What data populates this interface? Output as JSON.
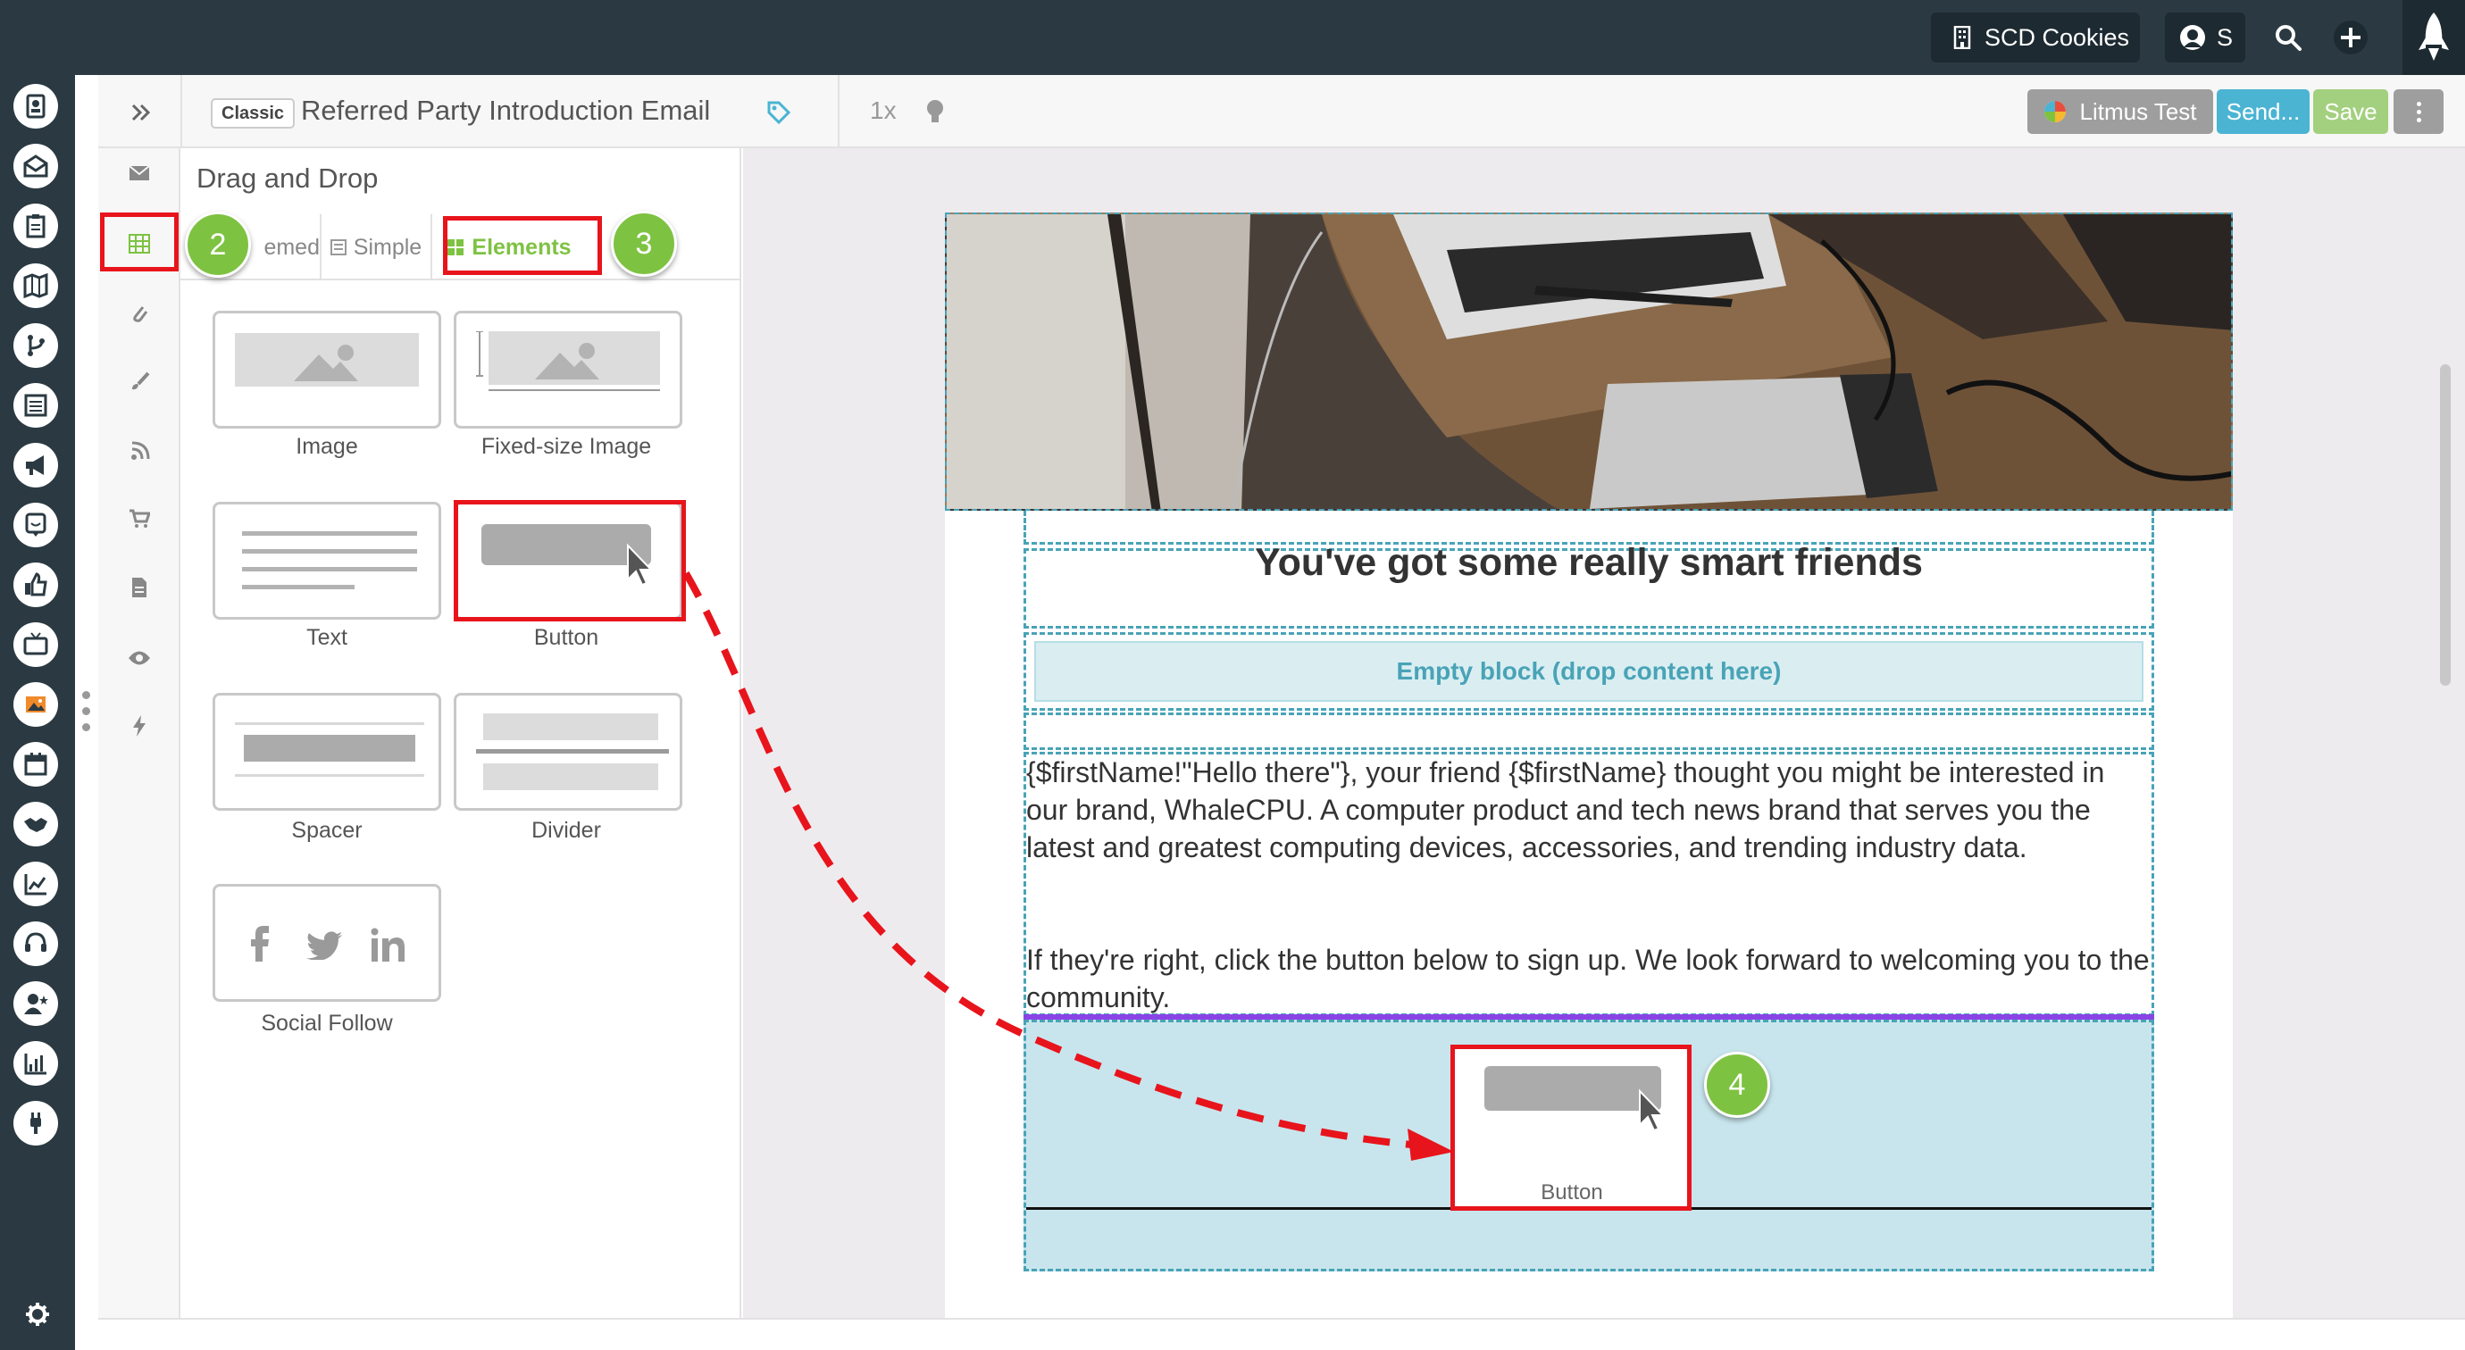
{
  "topbar": {
    "workspace": "SCD Cookies",
    "user_initial": "S"
  },
  "header": {
    "badge": "Classic",
    "title": "Referred Party Introduction Email",
    "zoom": "1x",
    "litmus_label": "Litmus Test",
    "send_label": "Send...",
    "save_label": "Save"
  },
  "palette": {
    "title": "Drag and Drop",
    "tabs": [
      "emed",
      "Simple",
      "Elements"
    ],
    "elements": [
      "Image",
      "Fixed-size Image",
      "Text",
      "Button",
      "Spacer",
      "Divider",
      "Social Follow"
    ]
  },
  "email": {
    "heading": "You've got some really smart friends",
    "empty_block": "Empty block (drop content here)",
    "paragraph1": "{$firstName!\"Hello there\"}, your friend {$firstName} thought you might be interested in our brand, WhaleCPU. A computer product and tech news brand that serves you the latest and greatest computing devices, accessories, and trending industry data.",
    "paragraph2": "If they're right, click the button below to sign up. We look forward to welcoming you to the community.",
    "drop_label": "Button"
  },
  "badges": [
    "2",
    "3",
    "4"
  ],
  "colors": {
    "rail_bg": "#2b3a42",
    "accent_green": "#7ec242",
    "send_blue": "#4bb4d3",
    "save_green": "#a3d07e",
    "highlight_red": "#e8141c",
    "teal": "#49a3b7"
  },
  "icons": {
    "rail": [
      "contacts-icon",
      "email-icon",
      "clipboard-icon",
      "map-icon",
      "branch-icon",
      "list-icon",
      "megaphone-icon",
      "chat-icon",
      "thumbs-up-icon",
      "tv-icon",
      "image-icon",
      "calendar-icon",
      "handshake-icon",
      "chart-up-icon",
      "headset-icon",
      "user-star-icon",
      "bar-chart-icon",
      "plug-icon"
    ],
    "tools": [
      "envelope-icon",
      "grid-icon",
      "paperclip-icon",
      "brush-icon",
      "rss-icon",
      "cart-icon",
      "document-icon",
      "eye-icon",
      "bolt-icon"
    ]
  }
}
